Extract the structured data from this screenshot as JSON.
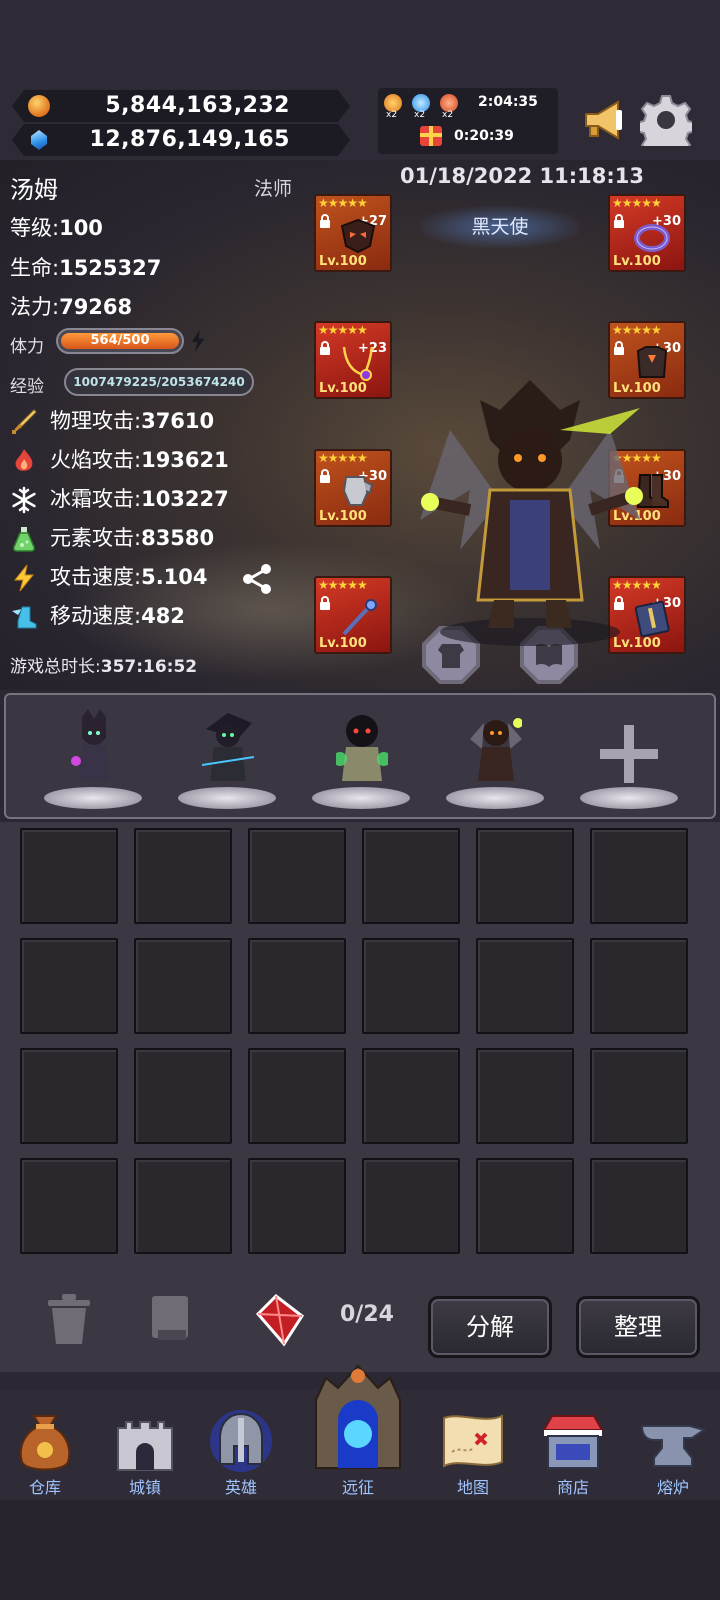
{
  "resources": {
    "gold": "5,844,163,232",
    "gems": "12,876,149,165"
  },
  "boosts": {
    "multipliers": [
      "x2",
      "x2",
      "x2"
    ],
    "boost_timer": "2:04:35",
    "gift_timer": "0:20:39"
  },
  "character": {
    "name": "汤姆",
    "class": "法师",
    "datetime": "01/18/2022 11:18:13",
    "title": "黑天使",
    "level_label": "等级:",
    "level": "100",
    "hp_label": "生命:",
    "hp": "1525327",
    "mp_label": "法力:",
    "mp": "79268",
    "stamina_label": "体力",
    "stamina": "564/500",
    "stamina_ratio": 1.0,
    "exp_label": "经验",
    "exp": "1007479225/2053674240",
    "exp_ratio": 0.49
  },
  "attacks": [
    {
      "label": "物理攻击:",
      "value": "37610",
      "icon": "sword-icon"
    },
    {
      "label": "火焰攻击:",
      "value": "193621",
      "icon": "fire-icon"
    },
    {
      "label": "冰霜攻击:",
      "value": "103227",
      "icon": "snowflake-icon"
    },
    {
      "label": "元素攻击:",
      "value": "83580",
      "icon": "potion-icon"
    },
    {
      "label": "攻击速度:",
      "value": "5.104",
      "icon": "lightning-icon"
    },
    {
      "label": "移动速度:",
      "value": "482",
      "icon": "winged-boot-icon"
    }
  ],
  "play_time": {
    "label": "游戏总时长:",
    "value": "357:16:52"
  },
  "equipment": [
    {
      "slot": "helmet",
      "stars": "★★★★★",
      "plus": "+27",
      "level": "Lv.100"
    },
    {
      "slot": "necklace",
      "stars": "★★★★★",
      "plus": "+23",
      "level": "Lv.100"
    },
    {
      "slot": "gauntlet",
      "stars": "★★★★★",
      "plus": "+30",
      "level": "Lv.100"
    },
    {
      "slot": "staff",
      "stars": "★★★★★",
      "plus": "",
      "level": "Lv.100"
    },
    {
      "slot": "ring",
      "stars": "★★★★★",
      "plus": "+30",
      "level": "Lv.100"
    },
    {
      "slot": "armor",
      "stars": "★★★★★",
      "plus": "+30",
      "level": "Lv.100"
    },
    {
      "slot": "boots",
      "stars": "★★★★★",
      "plus": "+30",
      "level": "Lv.100"
    },
    {
      "slot": "spellbook",
      "stars": "★★★★★",
      "plus": "+30",
      "level": "Lv.100"
    }
  ],
  "inventory": {
    "rows": 4,
    "cols": 6,
    "capacity": "0/24",
    "decompose_label": "分解",
    "sort_label": "整理"
  },
  "colors": {
    "accent_orange": "#d8561a",
    "nav_label": "#9fc4ff",
    "equip_orange": "#c0531d",
    "equip_red": "#d43a26"
  },
  "nav": [
    {
      "label": "仓库",
      "icon": "sack-icon"
    },
    {
      "label": "城镇",
      "icon": "castle-icon"
    },
    {
      "label": "英雄",
      "icon": "helmet-icon"
    },
    {
      "label": "远征",
      "icon": "portal-icon"
    },
    {
      "label": "地图",
      "icon": "map-icon"
    },
    {
      "label": "商店",
      "icon": "shop-icon"
    },
    {
      "label": "熔炉",
      "icon": "anvil-icon"
    }
  ]
}
